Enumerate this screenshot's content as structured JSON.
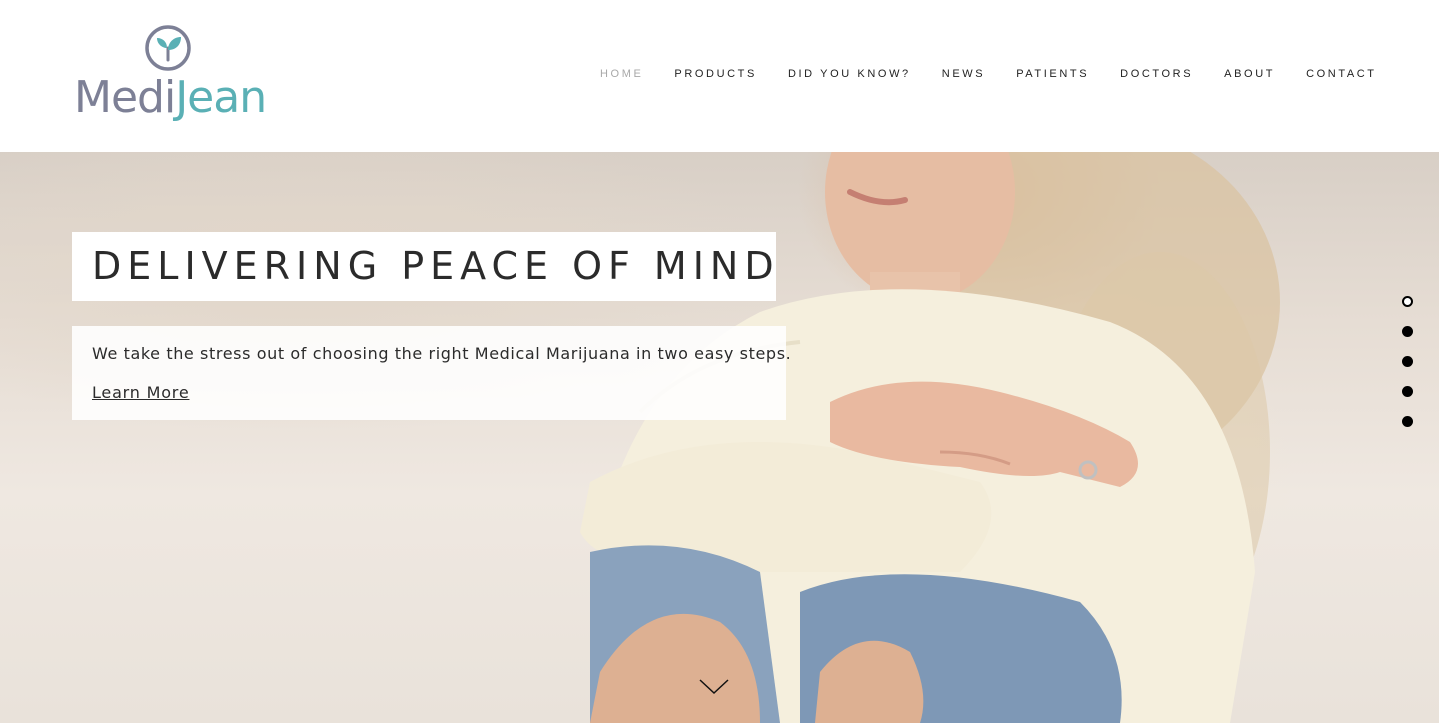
{
  "brand": {
    "logo_text_part1": "Medi",
    "logo_text_part2": "Jean",
    "logo_icon": "leaf-circle-icon",
    "primary_color": "#7d8096",
    "accent_color": "#5ab0b5"
  },
  "nav": {
    "items": [
      {
        "label": "HOME",
        "active": true
      },
      {
        "label": "PRODUCTS",
        "active": false
      },
      {
        "label": "DID YOU KNOW?",
        "active": false
      },
      {
        "label": "NEWS",
        "active": false
      },
      {
        "label": "PATIENTS",
        "active": false
      },
      {
        "label": "DOCTORS",
        "active": false
      },
      {
        "label": "ABOUT",
        "active": false
      },
      {
        "label": "CONTACT",
        "active": false
      }
    ]
  },
  "hero": {
    "headline": "DELIVERING PEACE OF MIND",
    "subtext": "We take the stress out of choosing the right Medical Marijuana in two easy steps.",
    "cta_label": "Learn More",
    "slide_count": 5,
    "active_slide": 1,
    "scroll_icon": "chevron-down-icon"
  }
}
